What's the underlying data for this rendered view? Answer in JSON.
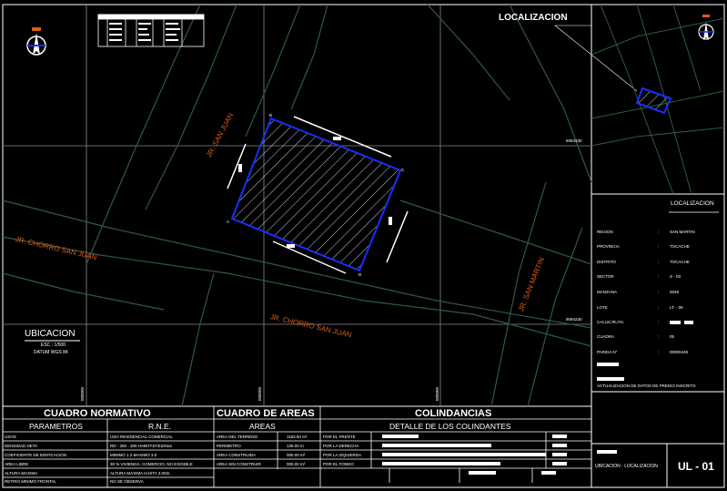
{
  "title_block": {
    "localizacion_top": "LOCALIZACION",
    "localizacion_panel": "LOCALIZACION",
    "ubicacion": "UBICACION",
    "escala": "ESC.: 1/500",
    "datum": "DATUM WGS 84",
    "sheet_code": "UL - 01",
    "sheet_desc": "UBICACION - LOCALIZACION",
    "actualizacion": "ACTUALIZACION DE DATOS DE PREDIO INSCRITO"
  },
  "info_panel": [
    {
      "label": "REGION",
      "value": "SAN MARTIN"
    },
    {
      "label": "PROVINCIA",
      "value": "TOCACHE"
    },
    {
      "label": "DISTRITO",
      "value": "TOCACHE"
    },
    {
      "label": "SECTOR",
      "value": "S - 03"
    },
    {
      "label": "MANZANA",
      "value": "0048"
    },
    {
      "label": "LOTE",
      "value": "LT. - 06"
    },
    {
      "label": "CALLE/JR./AV.",
      "value": ""
    },
    {
      "label": "CUADRA",
      "value": "05"
    },
    {
      "label": "PARIDA N°",
      "value": "00000448"
    }
  ],
  "streets": {
    "san_juan_top": "JR. SAN JUAN",
    "chorro_left": "JR. CHORRO SAN JUAN",
    "chorro_bottom": "JR. CHORRO SAN JUAN",
    "san_martin": "JR. SAN MARTIN"
  },
  "coords": {
    "n1": "9094330",
    "n2": "9094230",
    "e1": "000000",
    "e2": "000000",
    "e3": "000000"
  },
  "vertices": [
    "A",
    "B",
    "C",
    "D"
  ],
  "cuadro_normativo": {
    "title": "CUADRO NORMATIVO",
    "col1": "PARAMETROS",
    "col2": "R.N.E.",
    "rows": [
      {
        "param": "USOS",
        "value": "USO RESIDENCIAL COMERCIAL"
      },
      {
        "param": "DENSIDAD NETA",
        "value": "RD - 250 - 300 HABITANTES/Has"
      },
      {
        "param": "COEFICIENTE DE EDIFICACION",
        "value": "MINIMO 1.2 MAXIMO 3.0"
      },
      {
        "param": "AREA LIBRE",
        "value": "30 % VIVIENDA, COMERCIO, NO EXIGIBLE"
      },
      {
        "param": "ALTURA MAXIMA",
        "value": "ALTURA MAXIMA HASTA 3.00m."
      },
      {
        "param": "RETIRO MINIMO FRONTAL",
        "value": "NO SE OBSERVA"
      }
    ]
  },
  "cuadro_areas": {
    "title": "CUADRO DE AREAS",
    "col": "AREAS",
    "rows": [
      {
        "label": "AREA DEL TERRENO",
        "value": "1193.50 m²"
      },
      {
        "label": "PERIMETRO",
        "value": "139.00 m"
      },
      {
        "label": "AREA CONSTRUIDA",
        "value": "000.00 m²"
      },
      {
        "label": "AREA SIN CONSTRUIR",
        "value": "000.00 m²"
      }
    ]
  },
  "colindancias": {
    "title": "COLINDANCIAS",
    "sub": "DETALLE DE LOS COLINDANTES",
    "rows": [
      {
        "label": "POR EL FRENTE"
      },
      {
        "label": "POR LA DERECHA"
      },
      {
        "label": "POR LA IZQUIERDA"
      },
      {
        "label": "POR EL FONDO"
      }
    ]
  }
}
